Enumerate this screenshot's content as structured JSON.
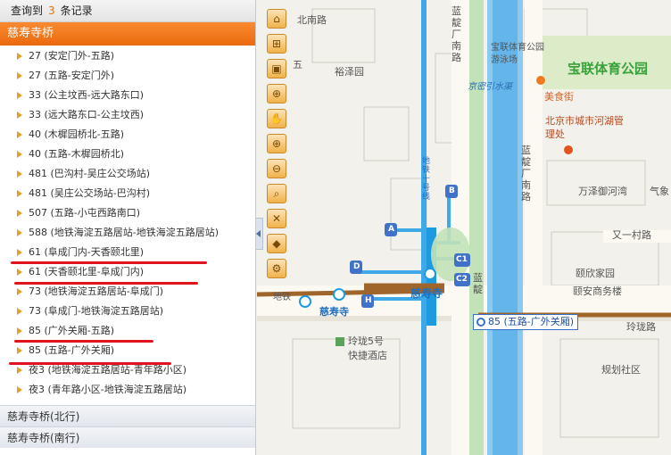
{
  "header": {
    "prefix": "查询到",
    "count": "3",
    "suffix": "条记录"
  },
  "group_main": {
    "title": "慈寿寺桥"
  },
  "routes": [
    "27 (安定门外-五路)",
    "27 (五路-安定门外)",
    "33 (公主坟西-远大路东口)",
    "33 (远大路东口-公主坟西)",
    "40 (木樨园桥北-五路)",
    "40 (五路-木樨园桥北)",
    "481 (巴沟村-吴庄公交场站)",
    "481 (吴庄公交场站-巴沟村)",
    "507 (五路-小屯西路南口)",
    "588 (地铁海淀五路居站-地铁海淀五路居站)",
    "61 (阜成门内-天香颐北里)",
    "61 (天香颐北里-阜成门内)",
    "73 (地铁海淀五路居站-阜成门)",
    "73 (阜成门-地铁海淀五路居站)",
    "85 (广外关厢-五路)",
    "85 (五路-广外关厢)",
    "夜3 (地铁海淀五路居站-青年路小区)",
    "夜3 (青年路小区-地铁海淀五路居站)"
  ],
  "groups_other": [
    "慈寿寺桥(北行)",
    "慈寿寺桥(南行)"
  ],
  "map": {
    "labels": {
      "nanlu": "北南路",
      "wu": "五",
      "yuzeyuan": "裕泽园",
      "lanling_nanlu": "蓝靛厂南路",
      "baolian_pool": "宝联体育公园游泳场",
      "baolian_park": "宝联体育公园",
      "jingmi": "京密引水渠",
      "meishijie": "美食街",
      "hehu": "北京市城市河湖管理处",
      "metro10": "地铁十号线",
      "lanling_road": "蓝靛厂南路",
      "wanze": "万泽御河湾",
      "qixiang": "气象",
      "youyi": "又一村路",
      "yinxin": "颐欣家园",
      "yian": "颐安商务楼",
      "cishousi_big": "慈寿寺",
      "cishousi_small": "慈寿寺",
      "dixiao": "地铁",
      "linglong": "玲珑路",
      "linglong5": "玲珑5号",
      "kuaijie": "快捷酒店",
      "guihua": "规划社区",
      "lan": "蓝靛"
    },
    "exits": [
      "A",
      "B",
      "C1",
      "C2",
      "D",
      "H"
    ],
    "route_tag": "85 (五路-广外关厢)"
  },
  "toolbar": [
    "⌂",
    "⊞",
    "▣",
    "⊕",
    "✋",
    "⊕",
    "⊖",
    "⌕",
    "✕",
    "◆",
    "⚙"
  ],
  "colors": {
    "accent": "#ea6a0c",
    "water": "#63b5ea",
    "metro": "#1e9be0",
    "road": "#fbf9f2",
    "highlight": "#e0141e"
  }
}
